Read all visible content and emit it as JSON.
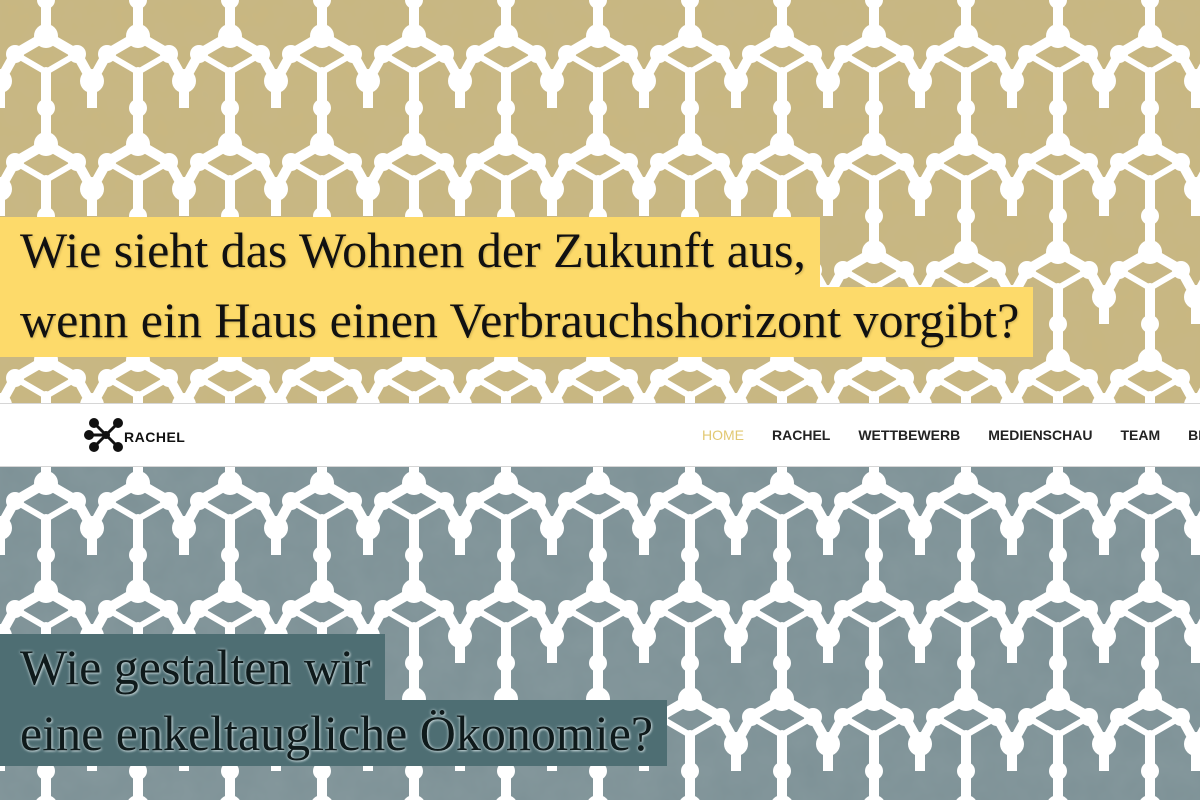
{
  "hero_top": {
    "line1": "Wie sieht das Wohnen der Zukunft aus,",
    "line2": "wenn ein Haus einen Verbrauchshorizont vorgibt?"
  },
  "navbar": {
    "logo_text": "RACHEL",
    "items": [
      {
        "label": "HOME",
        "active": true
      },
      {
        "label": "RACHEL",
        "active": false
      },
      {
        "label": "WETTBEWERB",
        "active": false
      },
      {
        "label": "MEDIENSCHAU",
        "active": false
      },
      {
        "label": "TEAM",
        "active": false
      },
      {
        "label": "BL",
        "active": false
      }
    ]
  },
  "hero_bottom": {
    "line1": "Wie gestalten wir",
    "line2": "eine enkeltaugliche Ökonomie?"
  },
  "colors": {
    "gold_background": "#c9b780",
    "gold_highlight": "#fdda6a",
    "slate_background": "#7d9196",
    "slate_highlight": "#4e6e73",
    "nav_active": "#e2c872"
  },
  "icons": {
    "logo": "molecule-icon",
    "pattern": "hexagonal-lattice-pattern"
  }
}
